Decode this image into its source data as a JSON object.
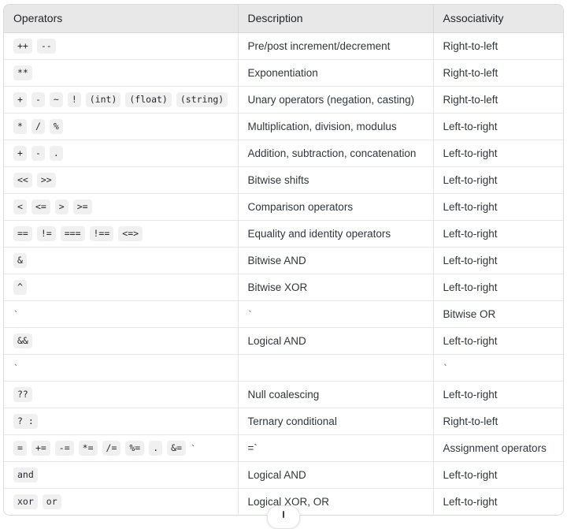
{
  "table": {
    "columns": [
      {
        "key": "operators",
        "label": "Operators"
      },
      {
        "key": "description",
        "label": "Description"
      },
      {
        "key": "associativity",
        "label": "Associativity"
      }
    ],
    "rows": [
      {
        "operators_chips": [
          "++",
          "--"
        ],
        "operators_bare": "",
        "description": "Pre/post increment/decrement",
        "associativity": "Right-to-left"
      },
      {
        "operators_chips": [
          "**"
        ],
        "operators_bare": "",
        "description": "Exponentiation",
        "associativity": "Right-to-left"
      },
      {
        "operators_chips": [
          "+",
          "-",
          "~",
          "!",
          "(int)",
          "(float)",
          "(string)"
        ],
        "operators_bare": "",
        "description": "Unary operators (negation, casting)",
        "associativity": "Right-to-left"
      },
      {
        "operators_chips": [
          "*",
          "/",
          "%"
        ],
        "operators_bare": "",
        "description": "Multiplication, division, modulus",
        "associativity": "Left-to-right"
      },
      {
        "operators_chips": [
          "+",
          "-",
          "."
        ],
        "operators_bare": "",
        "description": "Addition, subtraction, concatenation",
        "associativity": "Left-to-right"
      },
      {
        "operators_chips": [
          "<<",
          ">>"
        ],
        "operators_bare": "",
        "description": "Bitwise shifts",
        "associativity": "Left-to-right"
      },
      {
        "operators_chips": [
          "<",
          "<=",
          ">",
          ">="
        ],
        "operators_bare": "",
        "description": "Comparison operators",
        "associativity": "Left-to-right"
      },
      {
        "operators_chips": [
          "==",
          "!=",
          "===",
          "!==",
          "<=>"
        ],
        "operators_bare": "",
        "description": "Equality and identity operators",
        "associativity": "Left-to-right"
      },
      {
        "operators_chips": [
          "&"
        ],
        "operators_bare": "",
        "description": "Bitwise AND",
        "associativity": "Left-to-right"
      },
      {
        "operators_chips": [
          "^"
        ],
        "operators_bare": "",
        "description": "Bitwise XOR",
        "associativity": "Left-to-right"
      },
      {
        "operators_chips": [],
        "operators_bare": "`",
        "description": "`",
        "associativity": "Bitwise OR"
      },
      {
        "operators_chips": [
          "&&"
        ],
        "operators_bare": "",
        "description": "Logical AND",
        "associativity": "Left-to-right"
      },
      {
        "operators_chips": [],
        "operators_bare": "`",
        "description": "",
        "associativity": "`"
      },
      {
        "operators_chips": [
          "??"
        ],
        "operators_bare": "",
        "description": "Null coalescing",
        "associativity": "Left-to-right"
      },
      {
        "operators_chips": [
          "? :"
        ],
        "operators_bare": "",
        "description": "Ternary conditional",
        "associativity": "Right-to-left"
      },
      {
        "operators_chips": [
          "=",
          "+=",
          "-=",
          "*=",
          "/=",
          "%=",
          ".",
          "&="
        ],
        "operators_bare": "`",
        "description": "=`",
        "associativity": "Assignment operators"
      },
      {
        "operators_chips": [
          "and"
        ],
        "operators_bare": "",
        "description": "Logical AND",
        "associativity": "Left-to-right"
      },
      {
        "operators_chips": [
          "xor",
          "or"
        ],
        "operators_bare": "",
        "description": "Logical XOR, OR",
        "associativity": "Left-to-right"
      }
    ]
  },
  "overlay": {
    "scroll_pill_name": "scroll-indicator-pill"
  }
}
